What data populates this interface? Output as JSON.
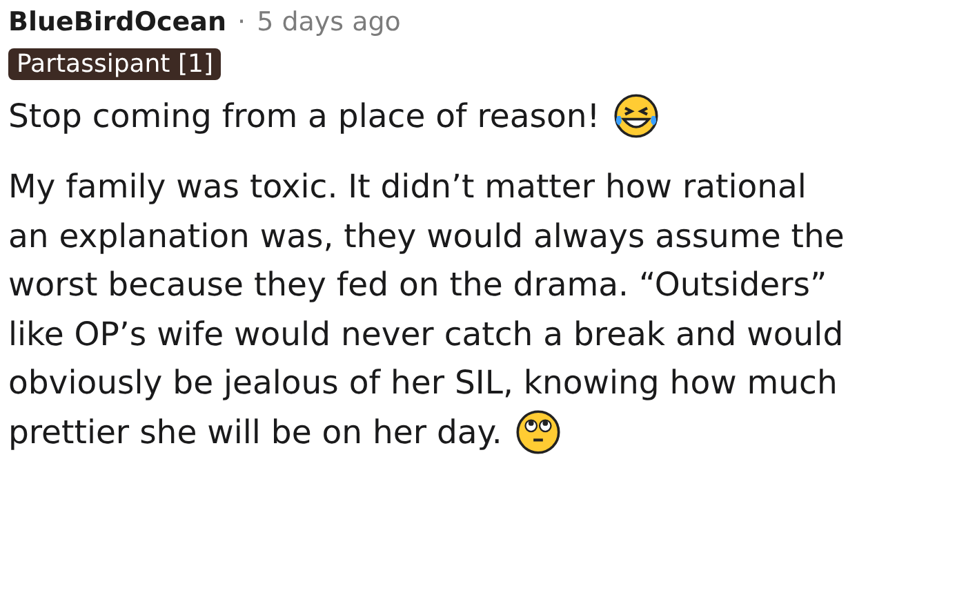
{
  "comment": {
    "author": "BlueBirdOcean",
    "separator": "·",
    "time": "5 days ago",
    "flair": "Partassipant [1]",
    "paragraphs": [
      {
        "lines": [
          "Stop coming from a place of reason!"
        ],
        "kind": "laughing"
      },
      {
        "lines": [
          "My family was toxic. It didn’t matter how rational",
          "an explanation was, they would always assume the",
          "worst because they fed on the drama. “Outsiders”",
          "like OP’s wife would never catch a break and would",
          "obviously be jealous of her SIL, knowing how much",
          "prettier she will be on her day."
        ],
        "kind": "eyeroll"
      }
    ]
  }
}
